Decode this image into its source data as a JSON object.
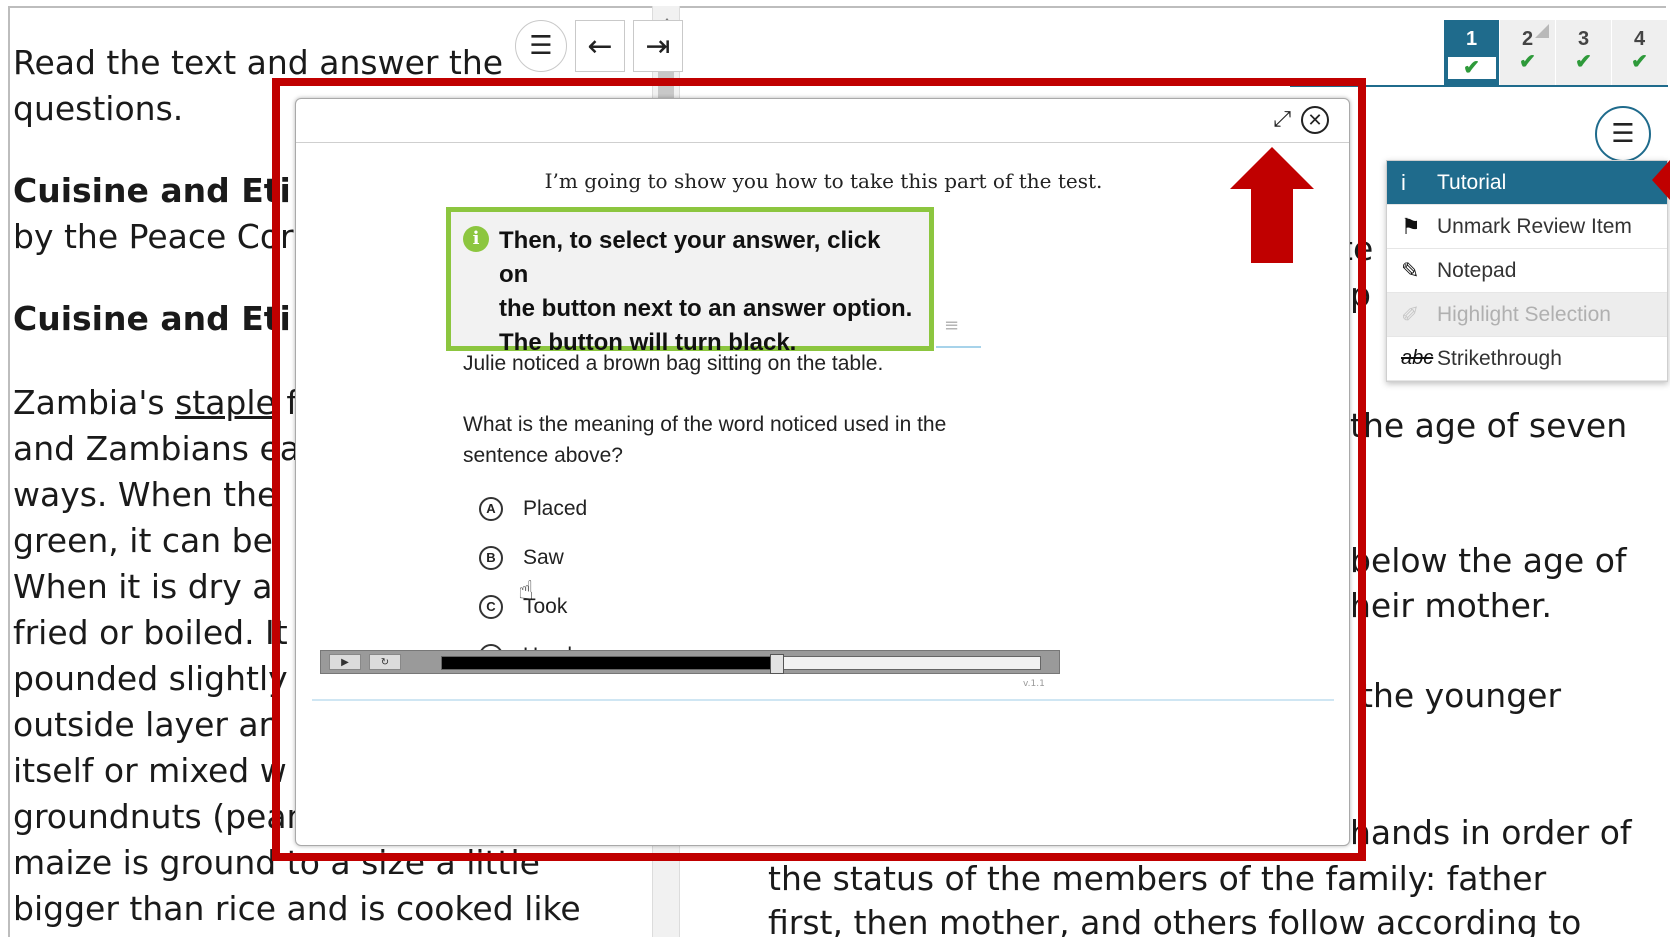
{
  "passage": {
    "intro_lines": [
      "Read the text and answer the",
      "questions."
    ],
    "title": "Cuisine and Eti",
    "byline": "by the Peace Cor",
    "title2": "Cuisine and Eti",
    "body_first_prefix": "Zambia's ",
    "body_first_underlined": "staple",
    "body_first_suffix": " f",
    "body_lines": [
      "and Zambians ea",
      "ways. When the",
      "green, it can be",
      "When it is dry a",
      "fried or boiled. It",
      "pounded slightly",
      "outside layer ar",
      "itself or mixed w",
      "groundnuts (peanuts). At times the",
      "maize is ground to a size a little",
      "bigger than rice and is cooked like"
    ]
  },
  "pane_toolbar": {
    "menu_icon": "menu-icon",
    "back_icon": "arrow-left-icon",
    "forward_icon": "arrow-right-bar-icon"
  },
  "right_pane": {
    "fragments": [
      "te",
      "p",
      "the age of seven",
      "below the age of",
      "heir mother.",
      "the younger",
      "hands in order of"
    ],
    "bottom_lines": [
      "the status of the members of the family: father",
      "first, then mother, and others follow according to"
    ]
  },
  "tabs": [
    {
      "label": "1",
      "status": "✔",
      "active": true
    },
    {
      "label": "2",
      "status": "✔",
      "flagged": true
    },
    {
      "label": "3",
      "status": "✔"
    },
    {
      "label": "4",
      "status": "✔"
    }
  ],
  "context_menu": {
    "items": [
      {
        "label": "Tutorial",
        "icon": "info-icon",
        "glyph": "i",
        "state": "active"
      },
      {
        "label": "Unmark Review Item",
        "icon": "flag-icon",
        "glyph": "⚑",
        "state": "normal"
      },
      {
        "label": "Notepad",
        "icon": "notepad-icon",
        "glyph": "✎",
        "state": "normal"
      },
      {
        "label": "Highlight Selection",
        "icon": "highlighter-icon",
        "glyph": "✐",
        "state": "disabled"
      },
      {
        "label": "Strikethrough",
        "icon": "strikethrough-icon",
        "glyph": "abc",
        "state": "normal"
      }
    ]
  },
  "dialog": {
    "caption": "I’m going to show you how to take this part of the test.",
    "callout_lines": [
      "Then, to select your answer, click on",
      "the button next to an answer option.",
      "The button will turn black."
    ],
    "stem": "Julie noticed a brown bag sitting on the table.",
    "question": "What is the meaning of the word noticed used in the sentence above?",
    "options": [
      {
        "letter": "A",
        "text": "Placed"
      },
      {
        "letter": "B",
        "text": "Saw"
      },
      {
        "letter": "C",
        "text": "Took"
      },
      {
        "letter": "D",
        "text": "Used"
      }
    ],
    "player": {
      "play_glyph": "▶",
      "replay_glyph": "↻",
      "progress": 0.56,
      "version": "v.1.1"
    }
  },
  "colors": {
    "accent": "#1f6b8c",
    "highlight_red": "#c00000",
    "callout_green": "#8cc63f",
    "check_green": "#2e9a3a"
  }
}
